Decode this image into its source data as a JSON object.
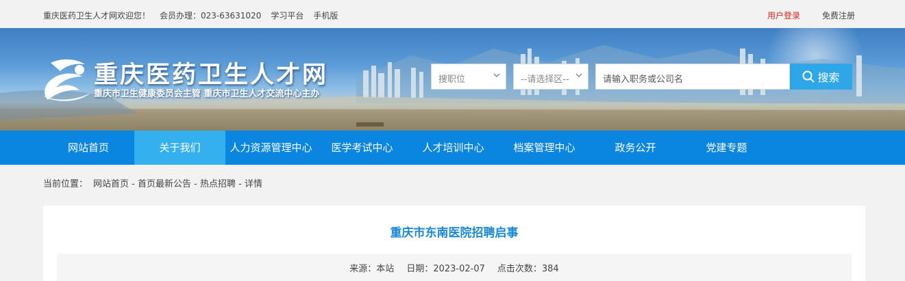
{
  "topbar": {
    "welcome": "重庆医药卫生人才网欢迎您！",
    "member_hotline": "会员办理：023-63631020",
    "study_platform": "学习平台",
    "mobile": "手机版",
    "login": "用户登录",
    "register": "免费注册"
  },
  "header": {
    "title": "重庆医药卫生人才网",
    "subtitle": "重庆市卫生健康委员会主管 重庆市卫生人才交流中心主办"
  },
  "search": {
    "position_select": "搜职位",
    "area_select": "--请选择区--",
    "placeholder": "请输入职务或公司名",
    "button": "搜索"
  },
  "nav": {
    "items": [
      "网站首页",
      "关于我们",
      "人力资源管理中心",
      "医学考试中心",
      "人才培训中心",
      "档案管理中心",
      "政务公开",
      "党建专题"
    ],
    "active_index": 1
  },
  "breadcrumb": {
    "prefix": "当前位置：",
    "home": "网站首页",
    "sep": " - ",
    "notice": "首页最新公告",
    "hot": "热点招聘",
    "detail": "详情"
  },
  "article": {
    "title": "重庆市东南医院招聘启事",
    "source": "来源：本站",
    "date": "日期：2023-02-07",
    "clicks": "点击次数：384"
  },
  "colors": {
    "nav_bg": "#0a86e0",
    "nav_active": "#35b0ee",
    "search_btn": "#2ea7e8",
    "title_blue": "#1a8ad6",
    "login_red": "#d9261c"
  }
}
